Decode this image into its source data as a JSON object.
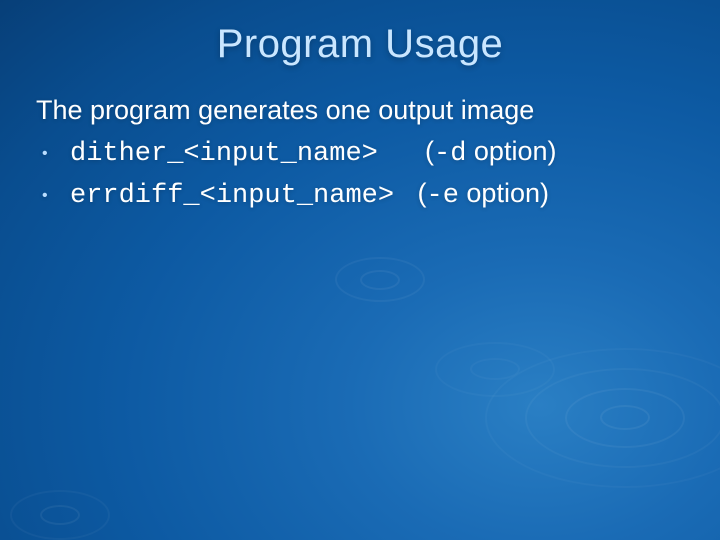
{
  "title": "Program Usage",
  "intro": "The program generates one output image",
  "items": [
    {
      "code": "dither_<input_name>",
      "suffix_a": "  (",
      "flag": "-d",
      "suffix_b": " option)"
    },
    {
      "code": "errdiff_<input_name>",
      "suffix_a": " (",
      "flag": "-e",
      "suffix_b": " option)"
    }
  ]
}
